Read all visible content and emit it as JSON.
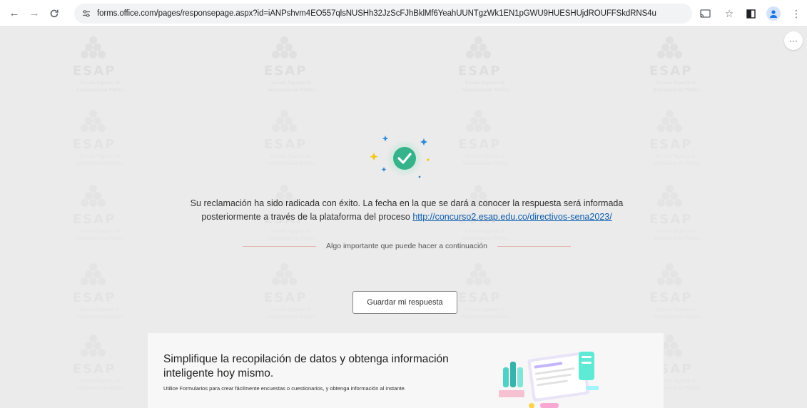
{
  "browser": {
    "url_host": "forms.office.com",
    "url_path": "/pages/responsepage.aspx?id=iANPshvm4EO557qlsNUSHh32JzScFJhBklMf6YeahUUNTgzWk1EN1pGWU9HUESHUjdROUFFSkdRNS4u",
    "icons": {
      "back": "arrow-left-icon",
      "forward": "arrow-right-icon",
      "reload": "reload-icon",
      "site_info": "tune-icon",
      "cast": "cast-icon",
      "bookmark": "star-icon",
      "sidepanel": "side-panel-icon",
      "profile": "profile-icon",
      "menu": "kebab-menu-icon"
    }
  },
  "page": {
    "watermark": {
      "word": "ESAP",
      "subtitle_line1": "Escuela Superior de",
      "subtitle_line2": "Administración Pública"
    },
    "more_button_label": "···",
    "confirmation": {
      "message_line1": "Su reclamación ha sido radicada con éxito. La fecha en la que se dará a conocer la respuesta será informada",
      "message_line2_prefix": "posteriormente a través de la plataforma del proceso ",
      "link_text": "http://concurso2.esap.edu.co/directivos-sena2023/",
      "divider_text": "Algo importante que puede hacer a continuación",
      "save_button": "Guardar mi respuesta"
    },
    "promo": {
      "title": "Simplifique la recopilación de datos y obtenga información inteligente hoy mismo.",
      "description": "Utilice Formularios para crear fácilmente encuestas o cuestionarios, y obtenga información al instante."
    }
  },
  "colors": {
    "check_green": "#36b38a",
    "sparkle_blue": "#2b88d8",
    "sparkle_yellow": "#f2c811",
    "link": "#0b5cad"
  }
}
